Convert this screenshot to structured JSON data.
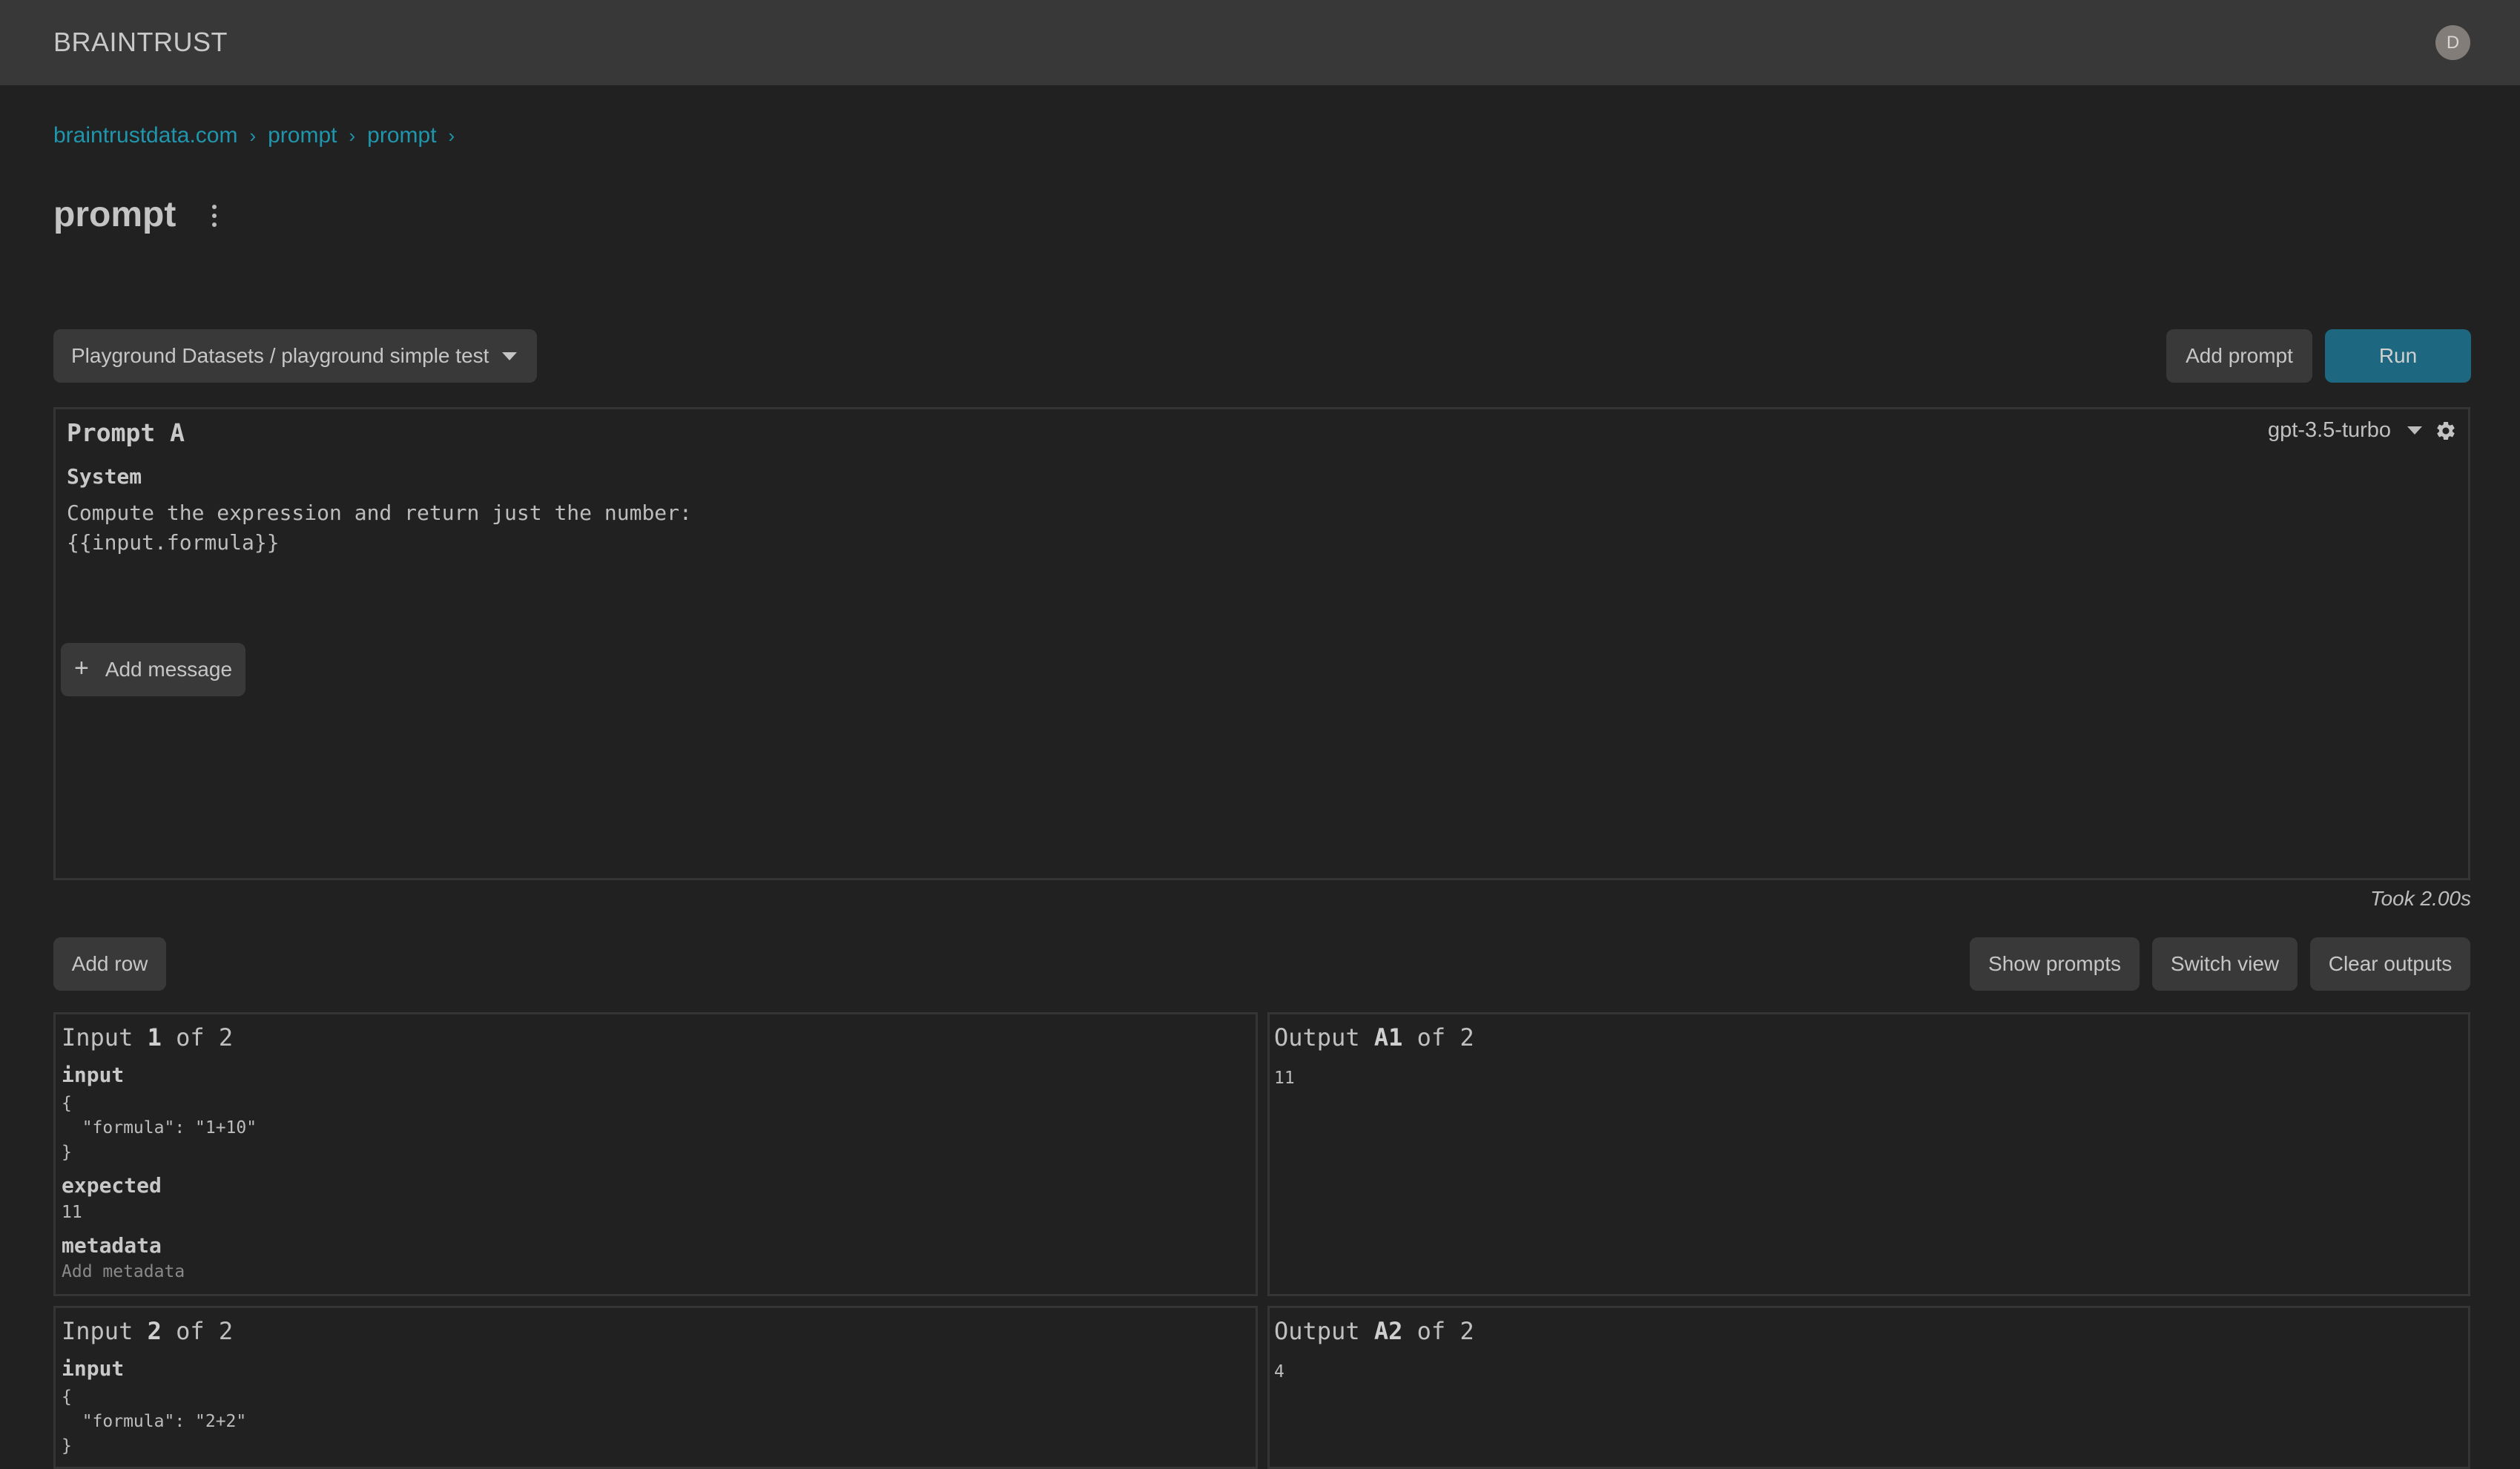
{
  "app": {
    "brand": "BRAINTRUST",
    "avatar_initial": "D"
  },
  "breadcrumb": [
    {
      "label": "braintrustdata.com"
    },
    {
      "label": "prompt"
    },
    {
      "label": "prompt"
    }
  ],
  "breadcrumb_separator": "›",
  "page": {
    "title": "prompt"
  },
  "toolbar": {
    "dataset_select": "Playground Datasets / playground simple test",
    "add_prompt_label": "Add prompt",
    "run_label": "Run"
  },
  "prompt_card": {
    "name": "Prompt A",
    "model": "gpt-3.5-turbo",
    "messages": [
      {
        "role": "System",
        "content": "Compute the expression and return just the number:\n{{input.formula}}"
      }
    ],
    "add_message_label": "Add message",
    "add_message_icon": "+"
  },
  "timing": "Took 2.00s",
  "grid_toolbar": {
    "add_row_label": "Add row",
    "show_prompts_label": "Show prompts",
    "switch_view_label": "Switch view",
    "clear_outputs_label": "Clear outputs"
  },
  "rows": [
    {
      "input_head": {
        "prefix": "Input ",
        "index": "1",
        "suffix": " of 2"
      },
      "input_label": "input",
      "input_value": "{\n  \"formula\": \"1+10\"\n}",
      "expected_label": "expected",
      "expected_value": "11",
      "metadata_label": "metadata",
      "metadata_placeholder": "Add metadata",
      "output_head": {
        "prefix": "Output ",
        "index": "A1",
        "suffix": " of 2"
      },
      "output_value": "11"
    },
    {
      "input_head": {
        "prefix": "Input ",
        "index": "2",
        "suffix": " of 2"
      },
      "input_label": "input",
      "input_value": "{\n  \"formula\": \"2+2\"\n}",
      "output_head": {
        "prefix": "Output ",
        "index": "A2",
        "suffix": " of 2"
      },
      "output_value": "4"
    }
  ],
  "colors": {
    "background": "#212121",
    "topbar": "#383838",
    "link": "#1f96ad",
    "primary_button": "#1d6880",
    "button": "#393939",
    "border": "#353535"
  }
}
